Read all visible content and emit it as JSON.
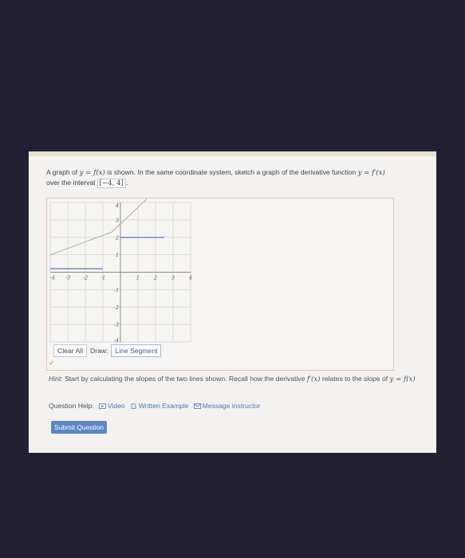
{
  "question": {
    "prefix": "A graph of",
    "eq1": "y = f(x)",
    "mid": "is shown. In the same coordinate system, sketch a graph of the derivative function",
    "eq2": "y = f′(x)",
    "suffix": "over the interval",
    "interval": "−4, 4",
    "end": "."
  },
  "graph": {
    "x_range": [
      -4,
      4
    ],
    "y_range": [
      -4,
      4
    ],
    "x_tick_labels": [
      "-4",
      "-3",
      "-2",
      "-1",
      "1",
      "2",
      "3",
      "4"
    ],
    "y_tick_labels": [
      "4",
      "3",
      "2",
      "1",
      "-1",
      "-2",
      "-3",
      "-4"
    ],
    "given_function": [
      [
        -4,
        1
      ],
      [
        -0.5,
        2.3
      ],
      [
        1.5,
        4.2
      ]
    ],
    "drawn_segments": [
      {
        "from": [
          -4,
          0.2
        ],
        "to": [
          -1,
          0.2
        ]
      },
      {
        "from": [
          0,
          2
        ],
        "to": [
          2.5,
          2
        ]
      }
    ],
    "colors": {
      "given": "#a9a9a9",
      "drawn": "#6b8fd8",
      "grid": "#d3d3d3",
      "axis": "#8a8a8a"
    }
  },
  "toolbar": {
    "clear_all": "Clear All",
    "draw_label": "Draw:",
    "line_segment": "Line Segment"
  },
  "hint": {
    "label": "Hint:",
    "text1": "Start by calculating the slopes of the two lines shown. Recall how the derivative",
    "eq1": "f′(x)",
    "text2": "relates to the slope of",
    "eq2": "y = f(x)"
  },
  "question_help": {
    "label": "Question Help:",
    "video": "Video",
    "written_example": "Written Example",
    "message_instructor": "Message instructor"
  },
  "submit": "Submit Question"
}
